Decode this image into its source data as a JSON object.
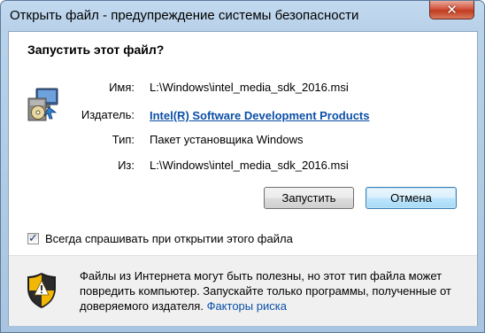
{
  "window": {
    "title": "Открыть файл - предупреждение системы безопасности",
    "close_glyph": "✕"
  },
  "dialog": {
    "heading": "Запустить этот файл?",
    "fields": {
      "name": {
        "label": "Имя:",
        "value": "L:\\Windows\\intel_media_sdk_2016.msi"
      },
      "publisher": {
        "label": "Издатель:",
        "value": "Intel(R) Software Development Products"
      },
      "type": {
        "label": "Тип:",
        "value": "Пакет установщика Windows"
      },
      "from": {
        "label": "Из:",
        "value": "L:\\Windows\\intel_media_sdk_2016.msi"
      }
    },
    "buttons": {
      "run": "Запустить",
      "cancel": "Отмена"
    },
    "checkbox": {
      "label": "Всегда спрашивать при открытии этого файла",
      "checked": true,
      "glyph": "✓"
    },
    "warning": {
      "text": "Файлы из Интернета могут быть полезны, но этот тип файла может повредить компьютер. Запускайте только программы, полученные от доверяемого издателя.",
      "link": "Факторы риска"
    }
  },
  "icons": {
    "file": "installer-package-icon",
    "warning": "security-shield-icon"
  },
  "colors": {
    "link": "#0b4fa8",
    "title_bar": "#b9d2ea",
    "close_button": "#c23d21",
    "default_button_border": "#3c7fb1",
    "footer_bg": "#f0f0f0"
  }
}
